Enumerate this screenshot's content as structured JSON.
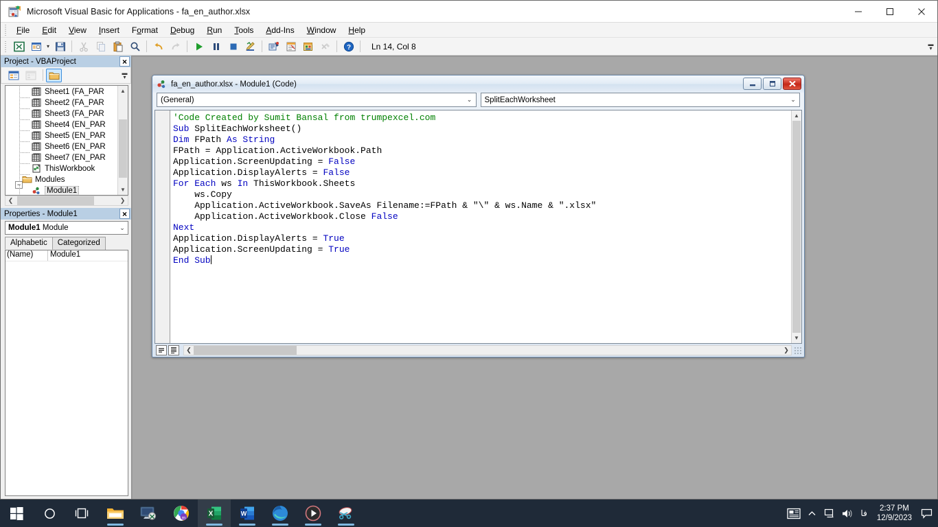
{
  "window": {
    "title": "Microsoft Visual Basic for Applications - fa_en_author.xlsx",
    "icon": "vba-excel-icon",
    "minimize_label": "Minimize",
    "restore_label": "Restore",
    "close_label": "Close"
  },
  "menubar": {
    "items": [
      {
        "label": "File",
        "accel": "F"
      },
      {
        "label": "Edit",
        "accel": "E"
      },
      {
        "label": "View",
        "accel": "V"
      },
      {
        "label": "Insert",
        "accel": "I"
      },
      {
        "label": "Format",
        "accel": "o"
      },
      {
        "label": "Debug",
        "accel": "D"
      },
      {
        "label": "Run",
        "accel": "R"
      },
      {
        "label": "Tools",
        "accel": "T"
      },
      {
        "label": "Add-Ins",
        "accel": "A"
      },
      {
        "label": "Window",
        "accel": "W"
      },
      {
        "label": "Help",
        "accel": "H"
      }
    ]
  },
  "toolbar": {
    "buttons": [
      {
        "name": "view-excel-icon",
        "tooltip": "View Microsoft Excel"
      },
      {
        "name": "insert-userform-icon",
        "tooltip": "Insert UserForm"
      },
      {
        "name": "insert-dropdown-caret-icon",
        "tooltip": "Insert"
      },
      {
        "name": "save-icon",
        "tooltip": "Save fa_en_author.xlsx"
      },
      {
        "name": "cut-icon",
        "tooltip": "Cut"
      },
      {
        "name": "copy-icon",
        "tooltip": "Copy"
      },
      {
        "name": "paste-icon",
        "tooltip": "Paste"
      },
      {
        "name": "find-icon",
        "tooltip": "Find"
      },
      {
        "name": "undo-icon",
        "tooltip": "Undo"
      },
      {
        "name": "redo-icon",
        "tooltip": "Redo"
      },
      {
        "name": "run-icon",
        "tooltip": "Run Sub/UserForm"
      },
      {
        "name": "pause-icon",
        "tooltip": "Break"
      },
      {
        "name": "stop-icon",
        "tooltip": "Reset"
      },
      {
        "name": "design-mode-icon",
        "tooltip": "Design Mode"
      },
      {
        "name": "project-explorer-icon",
        "tooltip": "Project Explorer"
      },
      {
        "name": "properties-window-icon",
        "tooltip": "Properties Window"
      },
      {
        "name": "object-browser-icon",
        "tooltip": "Object Browser"
      },
      {
        "name": "toolbox-icon",
        "tooltip": "Toolbox"
      },
      {
        "name": "help-icon",
        "tooltip": "Microsoft Visual Basic for Applications Help"
      }
    ],
    "position_indicator": "Ln 14, Col 8",
    "overflow_label": "Toolbar Options"
  },
  "project_explorer": {
    "title": "Project - VBAProject",
    "close_label": "×",
    "toolbar": [
      {
        "name": "view-code-icon",
        "label": "View Code",
        "state": "enabled"
      },
      {
        "name": "view-object-icon",
        "label": "View Object",
        "state": "disabled"
      },
      {
        "name": "toggle-folders-icon",
        "label": "Toggle Folders",
        "state": "active"
      }
    ],
    "tree": [
      {
        "label": "Sheet1 (FA_PAR",
        "icon": "worksheet-icon",
        "indent": 2,
        "selected": false
      },
      {
        "label": "Sheet2 (FA_PAR",
        "icon": "worksheet-icon",
        "indent": 2,
        "selected": false
      },
      {
        "label": "Sheet3 (FA_PAR",
        "icon": "worksheet-icon",
        "indent": 2,
        "selected": false
      },
      {
        "label": "Sheet4 (EN_PAR",
        "icon": "worksheet-icon",
        "indent": 2,
        "selected": false
      },
      {
        "label": "Sheet5 (EN_PAR",
        "icon": "worksheet-icon",
        "indent": 2,
        "selected": false
      },
      {
        "label": "Sheet6 (EN_PAR",
        "icon": "worksheet-icon",
        "indent": 2,
        "selected": false
      },
      {
        "label": "Sheet7 (EN_PAR",
        "icon": "worksheet-icon",
        "indent": 2,
        "selected": false
      },
      {
        "label": "ThisWorkbook",
        "icon": "workbook-icon",
        "indent": 2,
        "selected": false
      },
      {
        "label": "Modules",
        "icon": "folder-icon",
        "indent": 1,
        "selected": false,
        "expander": "−"
      },
      {
        "label": "Module1",
        "icon": "module-icon",
        "indent": 2,
        "selected": true
      }
    ]
  },
  "properties": {
    "title": "Properties - Module1",
    "close_label": "×",
    "object_name": "Module1",
    "object_type": "Module",
    "tabs": [
      {
        "label": "Alphabetic",
        "active": true
      },
      {
        "label": "Categorized",
        "active": false
      }
    ],
    "rows": [
      {
        "key": "(Name)",
        "value": "Module1"
      }
    ]
  },
  "code_window": {
    "title": "fa_en_author.xlsx - Module1 (Code)",
    "icon": "module-icon",
    "minimize_label": "Minimize",
    "maximize_label": "Maximize",
    "close_label": "×",
    "object_dropdown": "(General)",
    "procedure_dropdown": "SplitEachWorksheet",
    "view_buttons": [
      {
        "name": "procedure-view-icon",
        "label": "Procedure View"
      },
      {
        "name": "full-module-view-icon",
        "label": "Full Module View"
      }
    ],
    "code_lines": [
      [
        {
          "t": "'Code Created by Sumit Bansal from trumpexcel.com",
          "s": "c"
        }
      ],
      [
        {
          "t": "Sub ",
          "s": "k"
        },
        {
          "t": "SplitEachWorksheet()",
          "s": ""
        }
      ],
      [
        {
          "t": "Dim ",
          "s": "k"
        },
        {
          "t": "FPath ",
          "s": ""
        },
        {
          "t": "As String",
          "s": "k"
        }
      ],
      [
        {
          "t": "FPath = Application.ActiveWorkbook.Path",
          "s": ""
        }
      ],
      [
        {
          "t": "Application.ScreenUpdating = ",
          "s": ""
        },
        {
          "t": "False",
          "s": "k"
        }
      ],
      [
        {
          "t": "Application.DisplayAlerts = ",
          "s": ""
        },
        {
          "t": "False",
          "s": "k"
        }
      ],
      [
        {
          "t": "For Each ",
          "s": "k"
        },
        {
          "t": "ws ",
          "s": ""
        },
        {
          "t": "In ",
          "s": "k"
        },
        {
          "t": "ThisWorkbook.Sheets",
          "s": ""
        }
      ],
      [
        {
          "t": "    ws.Copy",
          "s": ""
        }
      ],
      [
        {
          "t": "    Application.ActiveWorkbook.SaveAs Filename:=FPath & \"\\\" & ws.Name & \".xlsx\"",
          "s": ""
        }
      ],
      [
        {
          "t": "    Application.ActiveWorkbook.Close ",
          "s": ""
        },
        {
          "t": "False",
          "s": "k"
        }
      ],
      [
        {
          "t": "Next",
          "s": "k"
        }
      ],
      [
        {
          "t": "Application.DisplayAlerts = ",
          "s": ""
        },
        {
          "t": "True",
          "s": "k"
        }
      ],
      [
        {
          "t": "Application.ScreenUpdating = ",
          "s": ""
        },
        {
          "t": "True",
          "s": "k"
        }
      ],
      [
        {
          "t": "End Sub",
          "s": "k",
          "cursor": true
        }
      ]
    ]
  },
  "taskbar": {
    "items": [
      {
        "name": "start-button",
        "label": "Start",
        "active": false
      },
      {
        "name": "search-button",
        "label": "Search",
        "active": false
      },
      {
        "name": "task-view-button",
        "label": "Task View",
        "active": false
      },
      {
        "name": "file-explorer-taskbar-icon",
        "label": "File Explorer",
        "active": false,
        "running": true
      },
      {
        "name": "remote-desktop-taskbar-icon",
        "label": "Remote Desktop",
        "active": false,
        "running": false
      },
      {
        "name": "chrome-taskbar-icon",
        "label": "Google Chrome",
        "active": false,
        "running": true
      },
      {
        "name": "excel-taskbar-icon",
        "label": "Microsoft Excel",
        "active": true,
        "running": true
      },
      {
        "name": "word-taskbar-icon",
        "label": "Microsoft Word",
        "active": false,
        "running": true
      },
      {
        "name": "edge-taskbar-icon",
        "label": "Microsoft Edge",
        "active": false,
        "running": true
      },
      {
        "name": "media-player-taskbar-icon",
        "label": "Media Player",
        "active": false,
        "running": true
      },
      {
        "name": "snipping-tool-taskbar-icon",
        "label": "Snipping Tool",
        "active": false,
        "running": true
      }
    ],
    "tray": {
      "news_label": "News and interests",
      "chevron_label": "Show hidden icons",
      "network_label": "Network",
      "volume_label": "Volume",
      "language": "فا",
      "time": "2:37 PM",
      "date": "12/9/2023",
      "notifications_label": "Notifications"
    }
  },
  "colors": {
    "accent": "#0078d7",
    "keyword": "#0000c0",
    "comment": "#008000",
    "pane_title_bg": "#b9cfe4",
    "mdi_bg": "#a8a8a8",
    "taskbar_bg": "#1f2a38"
  }
}
